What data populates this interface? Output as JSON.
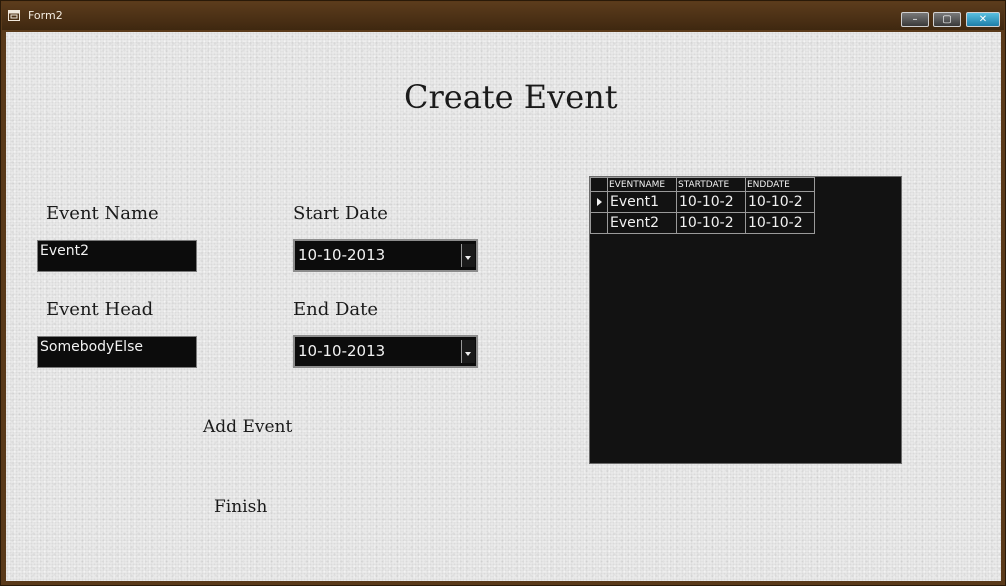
{
  "window": {
    "title": "Form2",
    "controls": {
      "minimize": "–",
      "maximize": "▢",
      "close": "✕"
    }
  },
  "form": {
    "title": "Create Event",
    "event_name": {
      "label": "Event Name",
      "value": "Event2"
    },
    "event_head": {
      "label": "Event Head",
      "value": "SomebodyElse"
    },
    "start_date": {
      "label": "Start Date",
      "value": "10-10-2013"
    },
    "end_date": {
      "label": "End Date",
      "value": "10-10-2013"
    },
    "add_button": "Add Event",
    "finish_button": "Finish"
  },
  "grid": {
    "columns": [
      "EVENTNAME",
      "STARTDATE",
      "ENDDATE"
    ],
    "rows": [
      [
        "Event1",
        "10-10-2",
        "10-10-2"
      ],
      [
        "Event2",
        "10-10-2",
        "10-10-2"
      ]
    ],
    "current_row": 0
  },
  "icons": {
    "window_icon": "form-window-icon",
    "dropdown": "chevron-down-icon",
    "row_selector": "row-pointer-icon"
  },
  "colors": {
    "title_bar": "#5a3a1a",
    "client_background": "#ebebeb",
    "control_background": "#0c0c0c",
    "control_text": "#f2f2f2",
    "close_button": "#2a9ac8"
  }
}
